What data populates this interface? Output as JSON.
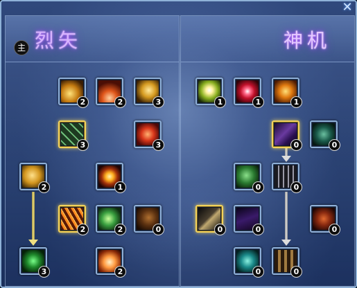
{
  "window": {
    "close_symbol": "✕"
  },
  "left_tree": {
    "title": "烈矢",
    "badge": "主"
  },
  "right_tree": {
    "title": "神机"
  },
  "skills": [
    {
      "id": "s1",
      "level": "2",
      "icon": "golden-claw-icon"
    },
    {
      "id": "s2",
      "level": "2",
      "icon": "fire-burst-icon"
    },
    {
      "id": "s3",
      "level": "3",
      "icon": "golden-horn-icon"
    },
    {
      "id": "s4",
      "level": "3",
      "icon": "green-arrows-icon"
    },
    {
      "id": "s5",
      "level": "3",
      "icon": "red-shield-icon"
    },
    {
      "id": "s6",
      "level": "2",
      "icon": "golden-leaf-icon"
    },
    {
      "id": "s7",
      "level": "1",
      "icon": "sun-wheel-icon"
    },
    {
      "id": "s8",
      "level": "2",
      "icon": "fire-rain-icon"
    },
    {
      "id": "s9",
      "level": "2",
      "icon": "green-swirl-icon"
    },
    {
      "id": "s10",
      "level": "0",
      "icon": "bow-icon"
    },
    {
      "id": "s11",
      "level": "3",
      "icon": "green-beast-icon"
    },
    {
      "id": "s12",
      "level": "2",
      "icon": "explosion-icon"
    },
    {
      "id": "s13",
      "level": "1",
      "icon": "light-burst-icon"
    },
    {
      "id": "s14",
      "level": "1",
      "icon": "red-star-icon"
    },
    {
      "id": "s15",
      "level": "1",
      "icon": "orange-vortex-icon"
    },
    {
      "id": "s16",
      "level": "0",
      "icon": "purple-slash-icon"
    },
    {
      "id": "s17",
      "level": "0",
      "icon": "green-serpent-icon"
    },
    {
      "id": "s18",
      "level": "0",
      "icon": "green-orb-icon"
    },
    {
      "id": "s19",
      "level": "0",
      "icon": "spike-trap-icon"
    },
    {
      "id": "s20",
      "level": "0",
      "icon": "dark-blade-icon"
    },
    {
      "id": "s21",
      "level": "0",
      "icon": "purple-wing-icon"
    },
    {
      "id": "s22",
      "level": "0",
      "icon": "red-rune-icon"
    },
    {
      "id": "s23",
      "level": "0",
      "icon": "teal-vortex-icon"
    },
    {
      "id": "s24",
      "level": "0",
      "icon": "totem-icon"
    }
  ]
}
